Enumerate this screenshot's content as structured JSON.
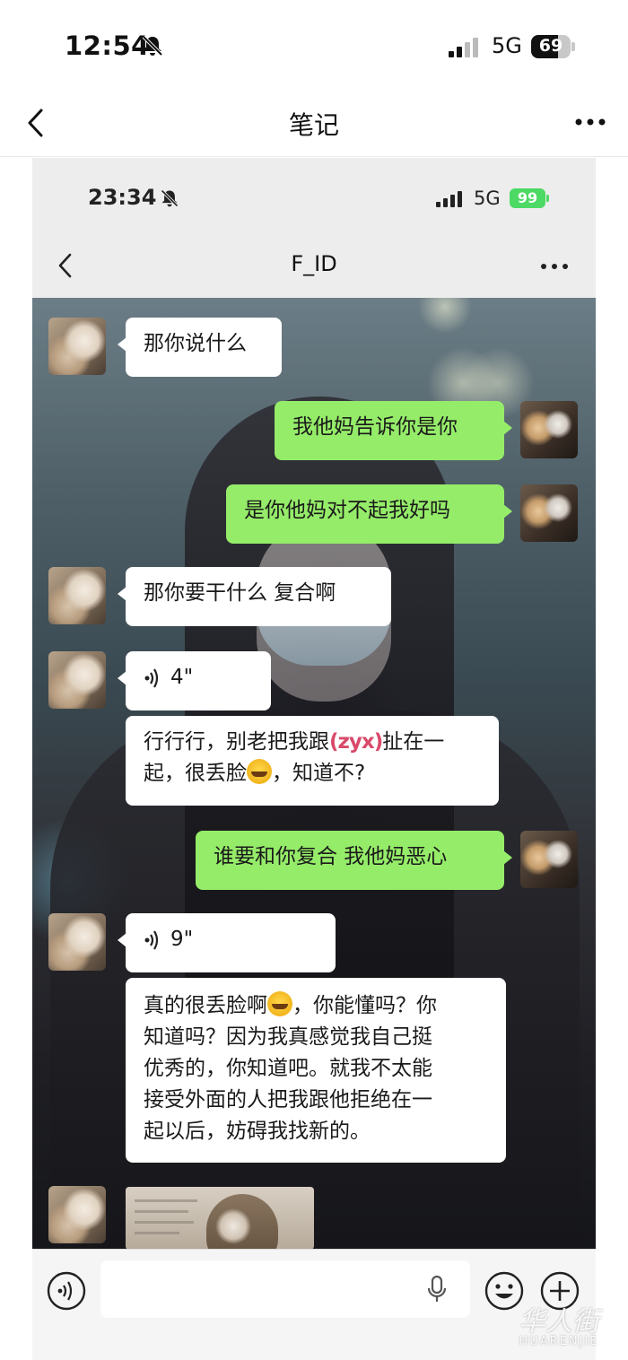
{
  "outer": {
    "status": {
      "time": "12:54",
      "network": "5G",
      "battery": "69"
    },
    "nav": {
      "title": "笔记"
    }
  },
  "screenshot": {
    "status": {
      "time": "23:34",
      "network": "5G",
      "battery": "99"
    },
    "nav": {
      "title": "F_ID"
    },
    "messages": [
      {
        "side": "left",
        "type": "text",
        "text": "那你说什么"
      },
      {
        "side": "right",
        "type": "text",
        "text": "我他妈告诉你是你"
      },
      {
        "side": "right",
        "type": "text",
        "text": "是你他妈对不起我好吗"
      },
      {
        "side": "left",
        "type": "text",
        "text": "那你要干什么 复合啊"
      },
      {
        "side": "left",
        "type": "voice",
        "duration": "4\""
      },
      {
        "side": "left",
        "type": "text",
        "line1a": "行行行，别老把我跟",
        "redact": "(zyx)",
        "line1b": "扯在一",
        "line2a": "起，很丢脸",
        "line2b": "，知道不?"
      },
      {
        "side": "right",
        "type": "text",
        "text": "谁要和你复合 我他妈恶心"
      },
      {
        "side": "left",
        "type": "voice",
        "duration": "9\""
      },
      {
        "side": "left",
        "type": "text",
        "l1a": "真的很丢脸啊",
        "l1b": "，你能懂吗？你",
        "l2": "知道吗？因为我真感觉我自己挺",
        "l3": "优秀的，你知道吧。就我不太能",
        "l4": "接受外面的人把我跟他拒绝在一",
        "l5": "起以后，妨碍我找新的。"
      },
      {
        "side": "left",
        "type": "image",
        "icon": "cat-photo"
      }
    ]
  },
  "watermark": {
    "cn": "华人街",
    "en": "HUARENJIE"
  },
  "colors": {
    "green_bubble": "#95ec69",
    "white_bubble": "#ffffff",
    "background": "#ededed"
  }
}
